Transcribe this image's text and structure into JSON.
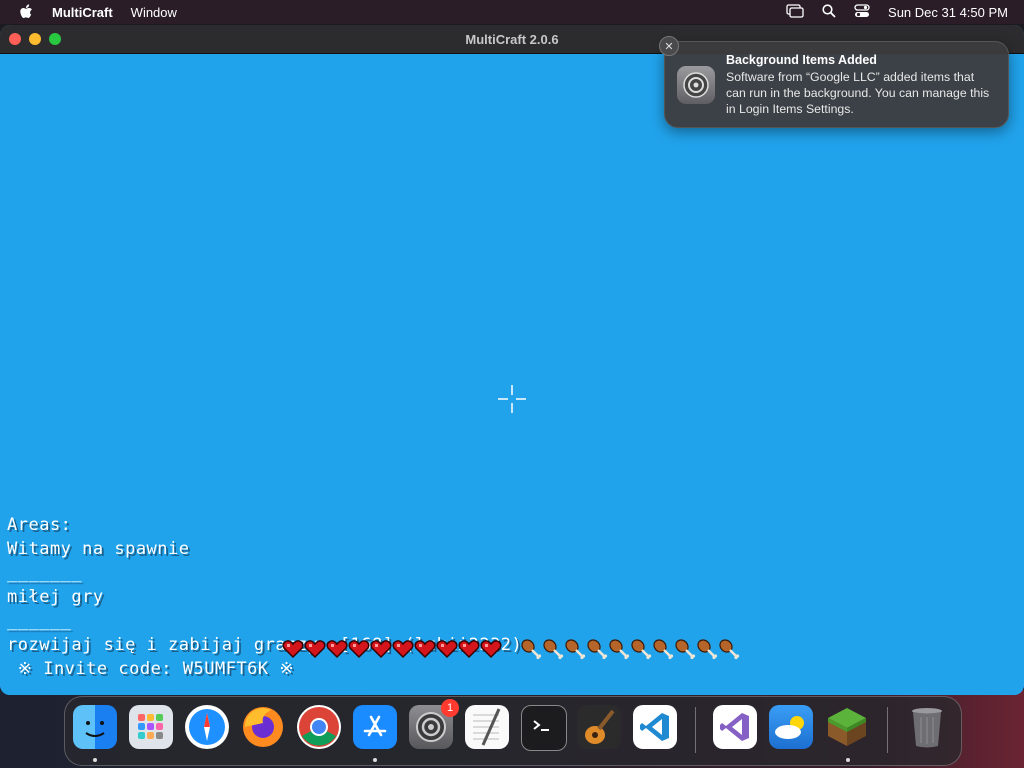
{
  "menubar": {
    "app_name": "MultiCraft",
    "menu_window": "Window",
    "clock": "Sun Dec 31  4:50 PM"
  },
  "window": {
    "title": "MultiCraft 2.0.6"
  },
  "game": {
    "chat_lines": [
      "Areas:",
      "Witamy na spawnie",
      "_______",
      "miłej gry",
      "______",
      "rozwijaj się i zabijaj graczy  [168] (lukii2232)",
      " ※ Invite code: W5UMFT6K ※"
    ],
    "health_hearts": 10,
    "hunger_drumsticks": 10
  },
  "notification": {
    "title": "Background Items Added",
    "body": "Software from “Google LLC” added items that can run in the background. You can manage this in Login Items Settings."
  },
  "dock": {
    "system_settings_badge": "1",
    "apps": [
      "finder",
      "launchpad",
      "safari",
      "firefox",
      "chrome",
      "app-store",
      "system-settings",
      "textedit",
      "terminal",
      "garageband",
      "vscode",
      "visual-studio",
      "weather",
      "minecraft",
      "trash"
    ]
  },
  "colors": {
    "sky": "#21a3ec",
    "menubar": "#2a1d28"
  }
}
